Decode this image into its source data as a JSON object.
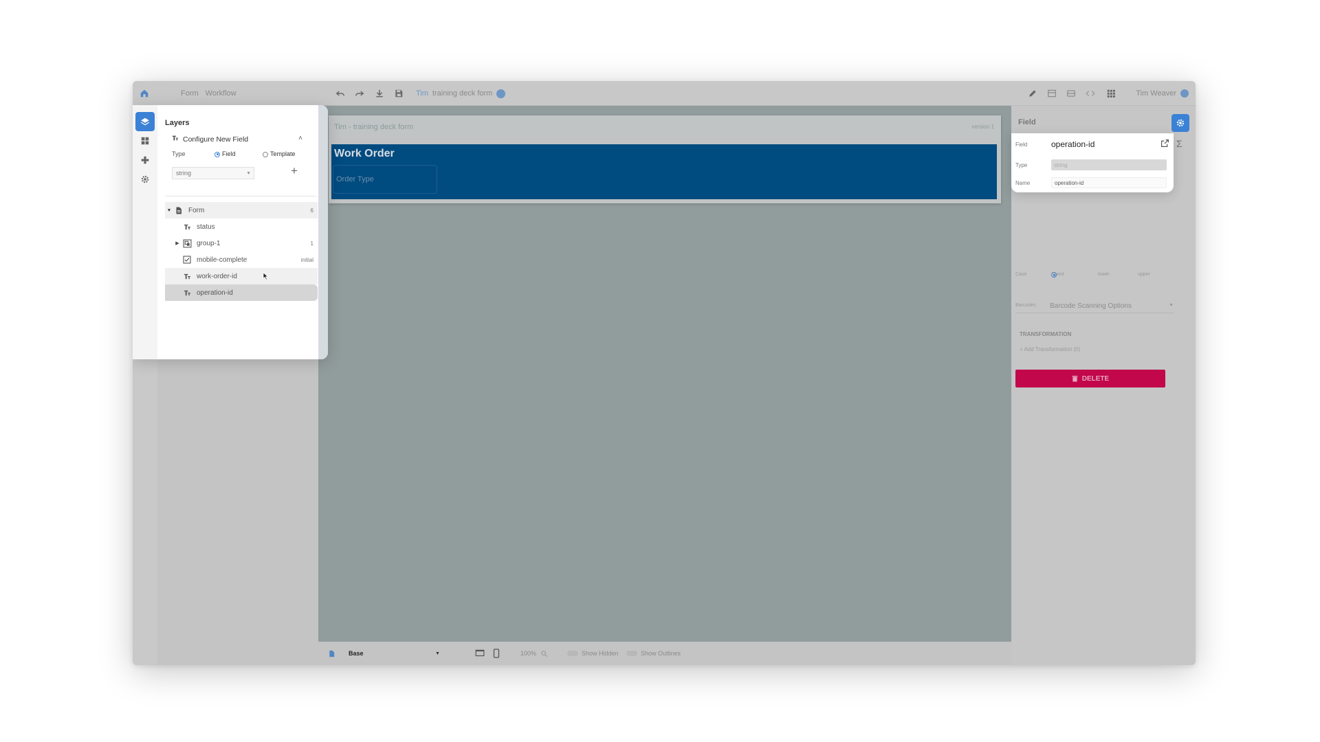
{
  "topbar": {
    "crumbs": [
      "Form",
      "Workflow"
    ],
    "doc_id": "Tim",
    "doc_name": "training deck form",
    "user_name": "Tim Weaver"
  },
  "layers": {
    "title": "Layers",
    "configure_label": "Configure New Field",
    "type_label": "Type",
    "option_field": "Field",
    "option_template": "Template",
    "selected_type": "string",
    "tree": [
      {
        "label": "Form",
        "count": "6",
        "icon": "document-icon"
      },
      {
        "label": "status",
        "count": "",
        "icon": "text-field-icon"
      },
      {
        "label": "group-1",
        "count": "1",
        "icon": "group-icon"
      },
      {
        "label": "mobile-complete",
        "count": "initial",
        "icon": "checkbox-icon"
      },
      {
        "label": "work-order-id",
        "count": "",
        "icon": "text-field-icon"
      },
      {
        "label": "operation-id",
        "count": "",
        "icon": "text-field-icon"
      }
    ]
  },
  "canvas": {
    "form_title": "Tim - training deck form",
    "version": "version 1",
    "panel_title": "Work Order",
    "field_placeholder": "Order Type"
  },
  "bottombar": {
    "base_label": "Base",
    "zoom": "100%",
    "show_hidden": "Show Hidden",
    "show_outlines": "Show Outlines"
  },
  "field_panel": {
    "title": "Field",
    "field_label": "Field",
    "field_value": "operation-id",
    "type_label": "Type",
    "type_value": "string",
    "name_label": "Name",
    "name_value": "operation-id",
    "case_label": "Case",
    "case_options": [
      "mixed",
      "lower",
      "upper"
    ],
    "barcodes_label": "Barcodes",
    "barcodes_value": "Barcode Scanning Options",
    "transformation_header": "TRANSFORMATION",
    "add_transformation": "Add Transformation (0)",
    "delete_label": "DELETE"
  },
  "colors": {
    "accent": "#3b82d6",
    "work_order_panel": "#004b80",
    "delete": "#c2074a",
    "canvas": "#919c9c"
  }
}
